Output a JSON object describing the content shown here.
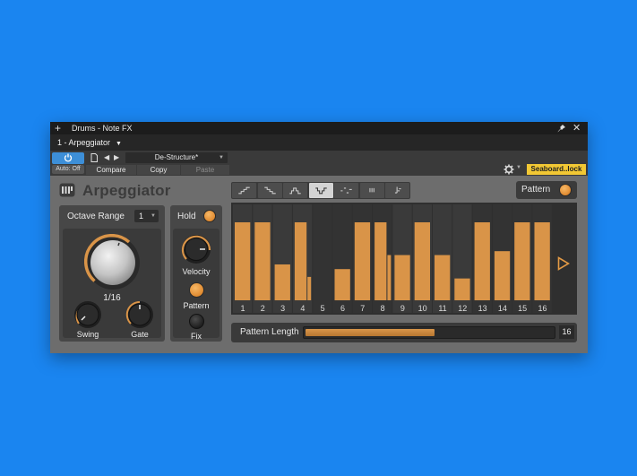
{
  "window": {
    "title": "Drums - Note FX",
    "instance": "1 - Arpeggiator"
  },
  "toolbar": {
    "auto_label": "Auto: Off",
    "preset_name": "De-Structure*",
    "compare_label": "Compare",
    "copy_label": "Copy",
    "paste_label": "Paste",
    "device_tag": "Seaboard..lock"
  },
  "plugin": {
    "title": "Arpeggiator",
    "pattern_label": "Pattern",
    "octave_label": "Octave Range",
    "octave_value": "1",
    "rate_value": "1/16",
    "swing_label": "Swing",
    "gate_label": "Gate",
    "hold_label": "Hold",
    "velocity_label": "Velocity",
    "pattern_btn_label": "Pattern",
    "fix_label": "Fix",
    "pattern_length_label": "Pattern Length",
    "pattern_length_value": "16",
    "pattern_length_fraction": 0.52,
    "pattern_types": [
      "up-icon",
      "down-icon",
      "up-down-icon",
      "down-up-icon",
      "random-icon",
      "chord-icon",
      "manual-icon"
    ],
    "active_pattern_type": 3
  },
  "steps": {
    "labels": [
      "1",
      "2",
      "3",
      "4",
      "5",
      "6",
      "7",
      "8",
      "9",
      "10",
      "11",
      "12",
      "13",
      "14",
      "15",
      "16"
    ],
    "levels": [
      [
        1.0
      ],
      [
        1.0
      ],
      [
        0.46
      ],
      [
        1.0,
        0.3
      ],
      [
        0
      ],
      [
        0.4
      ],
      [
        1.0
      ],
      [
        1.0,
        0.58
      ],
      [
        0.58
      ],
      [
        1.0
      ],
      [
        0.58
      ],
      [
        0.28
      ],
      [
        1.0
      ],
      [
        0.63
      ],
      [
        1.0
      ],
      [
        1.0
      ]
    ]
  },
  "colors": {
    "accent": "#d99448",
    "background": "#1a85f0",
    "panel": "#474747",
    "tag": "#f2c834"
  }
}
